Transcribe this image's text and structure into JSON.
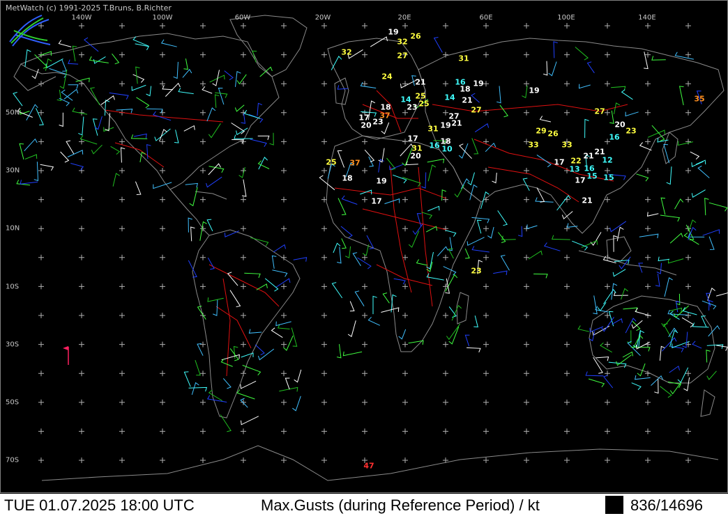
{
  "credit": "MetWatch  (c) 1991-2025 T.Bruns, B.Richter",
  "lon_labels": [
    "140W",
    "100W",
    "60W",
    "20W",
    "20E",
    "60E",
    "100E",
    "140E"
  ],
  "lat_labels": [
    "50N",
    "30N",
    "10N",
    "10S",
    "30S",
    "50S",
    "70S"
  ],
  "status": {
    "datetime": "TUE 01.07.2025 18:00 UTC",
    "parameter": "Max.Gusts (during Reference Period) / kt",
    "count": "836/14696"
  },
  "colors": {
    "background": "#000000",
    "coastline": "#8a8a8a",
    "borders": "#e01010",
    "graticule": "#b0b0b0",
    "gust_white": "#ffffff",
    "gust_yellow": "#ffff40",
    "gust_cyan": "#40ffff",
    "gust_orange": "#ff9020",
    "gust_red": "#ff3030"
  },
  "gust_reports": [
    {
      "value": "19",
      "color": "white"
    },
    {
      "value": "32",
      "color": "yellow"
    },
    {
      "value": "26",
      "color": "yellow"
    },
    {
      "value": "32",
      "color": "yellow"
    },
    {
      "value": "27",
      "color": "yellow"
    },
    {
      "value": "31",
      "color": "yellow"
    },
    {
      "value": "24",
      "color": "yellow"
    },
    {
      "value": "21",
      "color": "white"
    },
    {
      "value": "16",
      "color": "cyan"
    },
    {
      "value": "19",
      "color": "white"
    },
    {
      "value": "18",
      "color": "white"
    },
    {
      "value": "19",
      "color": "white"
    },
    {
      "value": "25",
      "color": "yellow"
    },
    {
      "value": "14",
      "color": "cyan"
    },
    {
      "value": "14",
      "color": "cyan"
    },
    {
      "value": "21",
      "color": "white"
    },
    {
      "value": "35",
      "color": "orange"
    },
    {
      "value": "18",
      "color": "white"
    },
    {
      "value": "23",
      "color": "white"
    },
    {
      "value": "25",
      "color": "yellow"
    },
    {
      "value": "27",
      "color": "yellow"
    },
    {
      "value": "37",
      "color": "orange"
    },
    {
      "value": "27",
      "color": "white"
    },
    {
      "value": "27",
      "color": "yellow"
    },
    {
      "value": "17",
      "color": "white"
    },
    {
      "value": "23",
      "color": "white"
    },
    {
      "value": "20",
      "color": "white"
    },
    {
      "value": "21",
      "color": "white"
    },
    {
      "value": "20",
      "color": "white"
    },
    {
      "value": "31",
      "color": "yellow"
    },
    {
      "value": "19",
      "color": "white"
    },
    {
      "value": "29",
      "color": "yellow"
    },
    {
      "value": "26",
      "color": "yellow"
    },
    {
      "value": "23",
      "color": "yellow"
    },
    {
      "value": "17",
      "color": "white"
    },
    {
      "value": "18",
      "color": "white"
    },
    {
      "value": "16",
      "color": "cyan"
    },
    {
      "value": "16",
      "color": "cyan"
    },
    {
      "value": "10",
      "color": "cyan"
    },
    {
      "value": "33",
      "color": "yellow"
    },
    {
      "value": "33",
      "color": "yellow"
    },
    {
      "value": "31",
      "color": "yellow"
    },
    {
      "value": "20",
      "color": "white"
    },
    {
      "value": "21",
      "color": "white"
    },
    {
      "value": "21",
      "color": "white"
    },
    {
      "value": "12",
      "color": "cyan"
    },
    {
      "value": "25",
      "color": "yellow"
    },
    {
      "value": "37",
      "color": "orange"
    },
    {
      "value": "17",
      "color": "white"
    },
    {
      "value": "22",
      "color": "yellow"
    },
    {
      "value": "13",
      "color": "cyan"
    },
    {
      "value": "16",
      "color": "cyan"
    },
    {
      "value": "15",
      "color": "cyan"
    },
    {
      "value": "15",
      "color": "cyan"
    },
    {
      "value": "18",
      "color": "white"
    },
    {
      "value": "19",
      "color": "white"
    },
    {
      "value": "17",
      "color": "white"
    },
    {
      "value": "17",
      "color": "white"
    },
    {
      "value": "21",
      "color": "white"
    },
    {
      "value": "23",
      "color": "yellow"
    },
    {
      "value": "47",
      "color": "red"
    }
  ]
}
